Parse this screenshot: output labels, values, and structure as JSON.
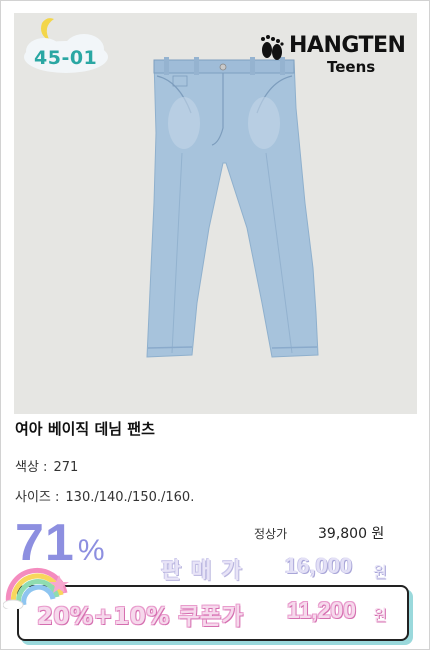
{
  "badge": {
    "code": "45-01"
  },
  "brand": {
    "name": "HANGTEN",
    "sub": "Teens"
  },
  "product": {
    "title": "여아 베이직 데님 팬츠",
    "color_label": "색상 :",
    "color_value": "271",
    "size_label": "사이즈 :",
    "size_value": "130./140./150./160."
  },
  "price": {
    "discount_number": "71",
    "discount_symbol": "%",
    "regular_label": "정상가",
    "regular_value": "39,800 원",
    "sale_label": "판매가",
    "sale_value": "16,000",
    "sale_unit": "원",
    "coupon_label": "20%+10% 쿠폰가",
    "coupon_value": "11,200",
    "coupon_unit": "원"
  },
  "colors": {
    "denim": "#a7c3dc",
    "photo_bg": "#e6e6e3",
    "discount": "#8d8fe0",
    "coupon_accent": "#d56fb0",
    "box_shadow": "#9ad9dc"
  }
}
